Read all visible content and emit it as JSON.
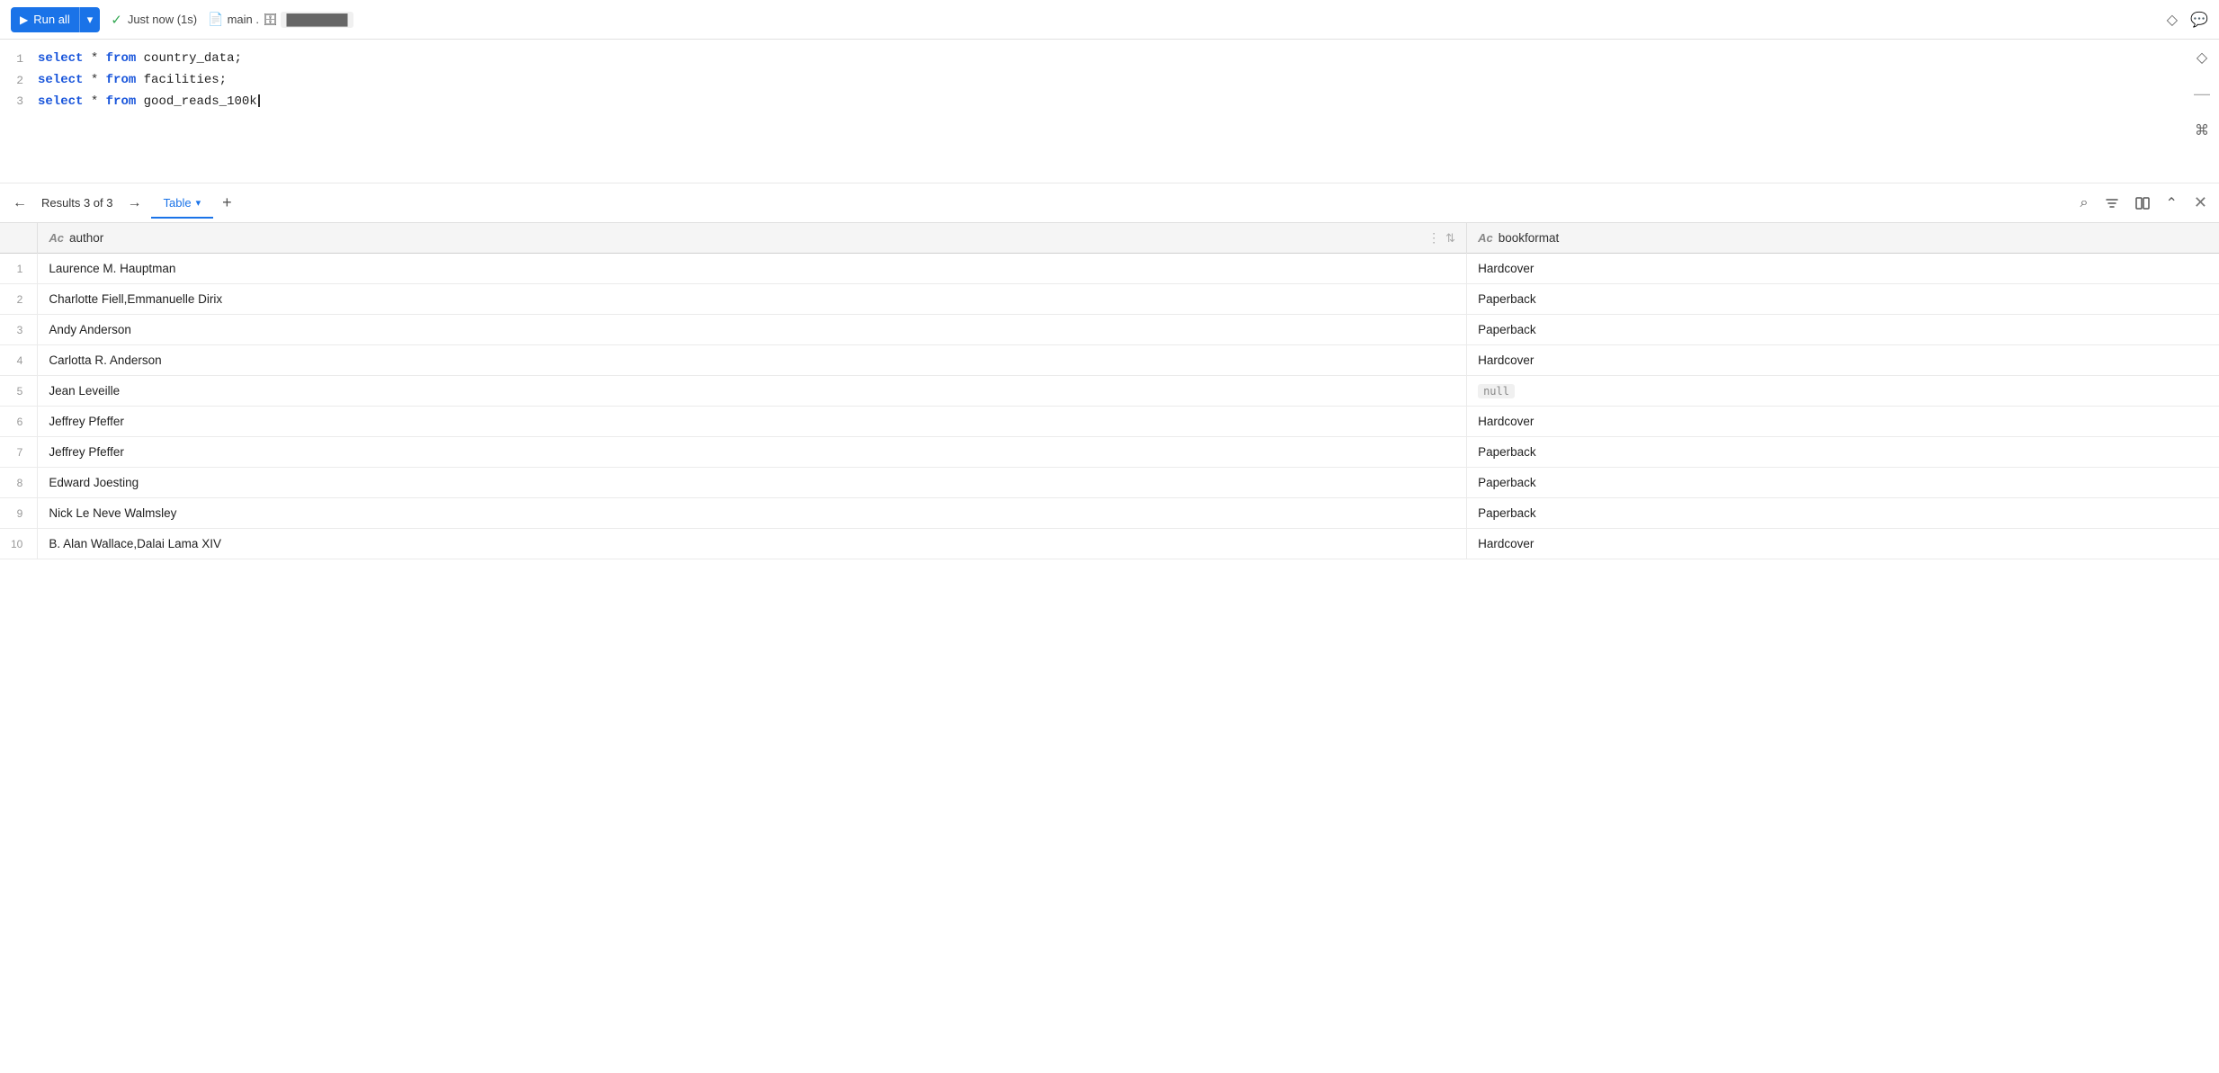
{
  "toolbar": {
    "run_all_label": "Run all",
    "status_label": "Just now (1s)",
    "db_prefix": "main .",
    "db_name": "████████"
  },
  "editor": {
    "lines": [
      {
        "num": "1",
        "code": "select * from country_data;"
      },
      {
        "num": "2",
        "code": "select * from facilities;"
      },
      {
        "num": "3",
        "code": "select * from good_reads_100k"
      }
    ]
  },
  "results": {
    "label": "Results 3 of 3",
    "tab_label": "Table",
    "columns": [
      {
        "name": "author",
        "icon": "text-icon"
      },
      {
        "name": "bookformat",
        "icon": "text-icon"
      }
    ],
    "rows": [
      {
        "num": 1,
        "author": "Laurence M. Hauptman",
        "bookformat": "Hardcover"
      },
      {
        "num": 2,
        "author": "Charlotte Fiell,Emmanuelle Dirix",
        "bookformat": "Paperback"
      },
      {
        "num": 3,
        "author": "Andy Anderson",
        "bookformat": "Paperback"
      },
      {
        "num": 4,
        "author": "Carlotta R. Anderson",
        "bookformat": "Hardcover"
      },
      {
        "num": 5,
        "author": "Jean Leveille",
        "bookformat": null
      },
      {
        "num": 6,
        "author": "Jeffrey Pfeffer",
        "bookformat": "Hardcover"
      },
      {
        "num": 7,
        "author": "Jeffrey Pfeffer",
        "bookformat": "Paperback"
      },
      {
        "num": 8,
        "author": "Edward Joesting",
        "bookformat": "Paperback"
      },
      {
        "num": 9,
        "author": "Nick Le Neve Walmsley",
        "bookformat": "Paperback"
      },
      {
        "num": 10,
        "author": "B. Alan Wallace,Dalai Lama XIV",
        "bookformat": "Hardcover"
      }
    ]
  },
  "icons": {
    "play": "▶",
    "chevron_down": "▾",
    "check": "✓",
    "left_arrow": "←",
    "right_arrow": "→",
    "plus": "+",
    "search": "⌕",
    "filter": "⊟",
    "columns": "⊞",
    "collapse": "⌃",
    "close": "✕",
    "diamond": "◇",
    "chat": "💬",
    "command": "⌘",
    "database": "🗄",
    "text_col": "Ac"
  },
  "colors": {
    "blue": "#1a73e8",
    "null_bg": "#f0f0f0",
    "null_text": "#888"
  }
}
